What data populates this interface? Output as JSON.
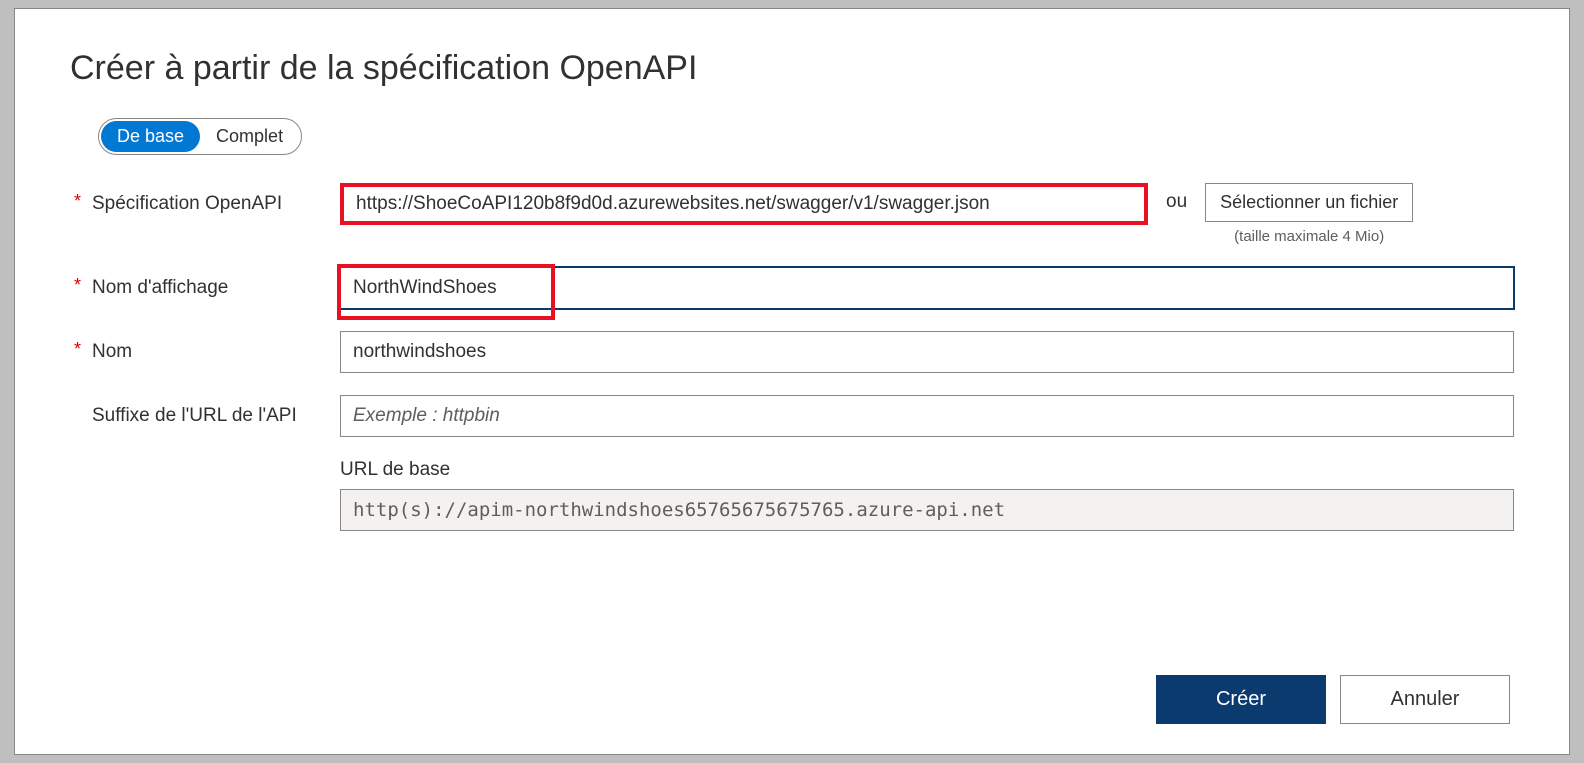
{
  "title": "Créer à partir de la spécification OpenAPI",
  "toggle": {
    "basic": "De base",
    "full": "Complet"
  },
  "fields": {
    "spec": {
      "label": "Spécification OpenAPI",
      "value": "https://ShoeCoAPI120b8f9d0d.azurewebsites.net/swagger/v1/swagger.json",
      "or": "ou",
      "selectFile": "Sélectionner un fichier",
      "maxSize": "(taille maximale 4 Mio)"
    },
    "displayName": {
      "label": "Nom d'affichage",
      "value": "NorthWindShoes"
    },
    "name": {
      "label": "Nom",
      "value": "northwindshoes"
    },
    "urlSuffix": {
      "label": "Suffixe de l'URL de l'API",
      "placeholder": "Exemple : httpbin",
      "value": ""
    },
    "baseUrl": {
      "label": "URL de base",
      "value": "http(s)://apim-northwindshoes65765675675765.azure-api.net"
    }
  },
  "footer": {
    "create": "Créer",
    "cancel": "Annuler"
  }
}
